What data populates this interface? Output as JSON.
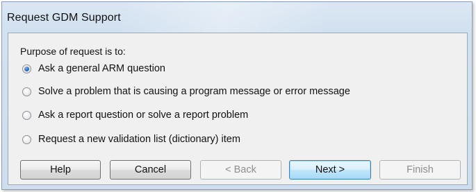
{
  "window": {
    "title": "Request GDM Support"
  },
  "group": {
    "label": "Purpose of request is to:"
  },
  "options": [
    {
      "label": "Ask a general ARM question",
      "selected": true
    },
    {
      "label": "Solve a problem that is causing a program message or error message",
      "selected": false
    },
    {
      "label": "Ask a report question or solve a report problem",
      "selected": false
    },
    {
      "label": "Request a new validation list (dictionary) item",
      "selected": false
    }
  ],
  "buttons": {
    "help": "Help",
    "cancel": "Cancel",
    "back": "< Back",
    "next": "Next >",
    "finish": "Finish"
  }
}
